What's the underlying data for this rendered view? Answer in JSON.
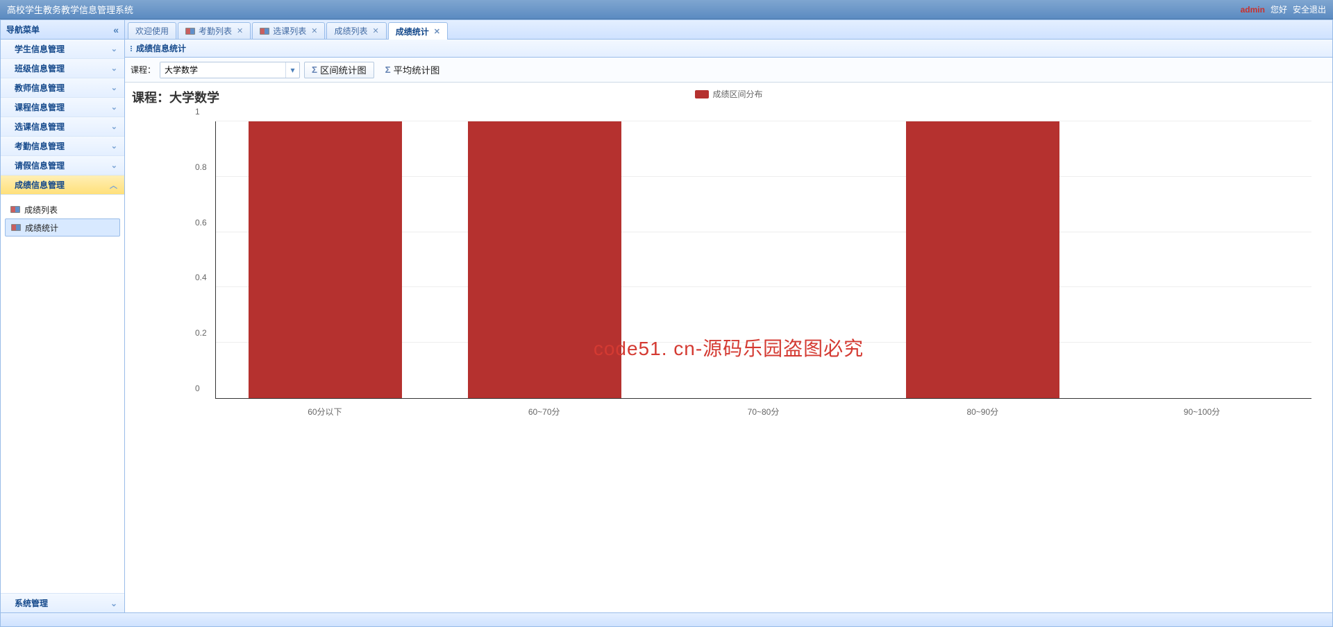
{
  "header": {
    "title": "高校学生教务教学信息管理系统",
    "user": "admin",
    "greeting": "您好",
    "logout": "安全退出"
  },
  "sidebar": {
    "title": "导航菜单",
    "items": [
      {
        "label": "学生信息管理",
        "active": false
      },
      {
        "label": "班级信息管理",
        "active": false
      },
      {
        "label": "教师信息管理",
        "active": false
      },
      {
        "label": "课程信息管理",
        "active": false
      },
      {
        "label": "选课信息管理",
        "active": false
      },
      {
        "label": "考勤信息管理",
        "active": false
      },
      {
        "label": "请假信息管理",
        "active": false
      },
      {
        "label": "成绩信息管理",
        "active": true
      }
    ],
    "sub_items": [
      {
        "label": "成绩列表",
        "selected": false
      },
      {
        "label": "成绩统计",
        "selected": true
      }
    ],
    "bottom": {
      "label": "系统管理"
    }
  },
  "tabs": [
    {
      "label": "欢迎使用",
      "icon": false,
      "closable": false,
      "active": false
    },
    {
      "label": "考勤列表",
      "icon": true,
      "closable": true,
      "active": false
    },
    {
      "label": "选课列表",
      "icon": true,
      "closable": true,
      "active": false
    },
    {
      "label": "成绩列表",
      "icon": false,
      "closable": true,
      "active": false
    },
    {
      "label": "成绩统计",
      "icon": false,
      "closable": true,
      "active": true
    }
  ],
  "panel": {
    "title": "成绩信息统计"
  },
  "toolbar": {
    "course_label": "课程：",
    "course_value": "大学数学",
    "interval_btn": "区间统计图",
    "avg_btn": "平均统计图"
  },
  "chart_title": "课程：大学数学",
  "legend_label": "成绩区间分布",
  "watermark": "code51. cn-源码乐园盗图必究",
  "chart_data": {
    "type": "bar",
    "title": "课程：大学数学",
    "legend": "成绩区间分布",
    "categories": [
      "60分以下",
      "60~70分",
      "70~80分",
      "80~90分",
      "90~100分"
    ],
    "values": [
      1,
      1,
      0,
      1,
      0
    ],
    "ylim": [
      0,
      1
    ],
    "yticks": [
      0,
      0.2,
      0.4,
      0.6,
      0.8,
      1
    ],
    "xlabel": "",
    "ylabel": ""
  }
}
